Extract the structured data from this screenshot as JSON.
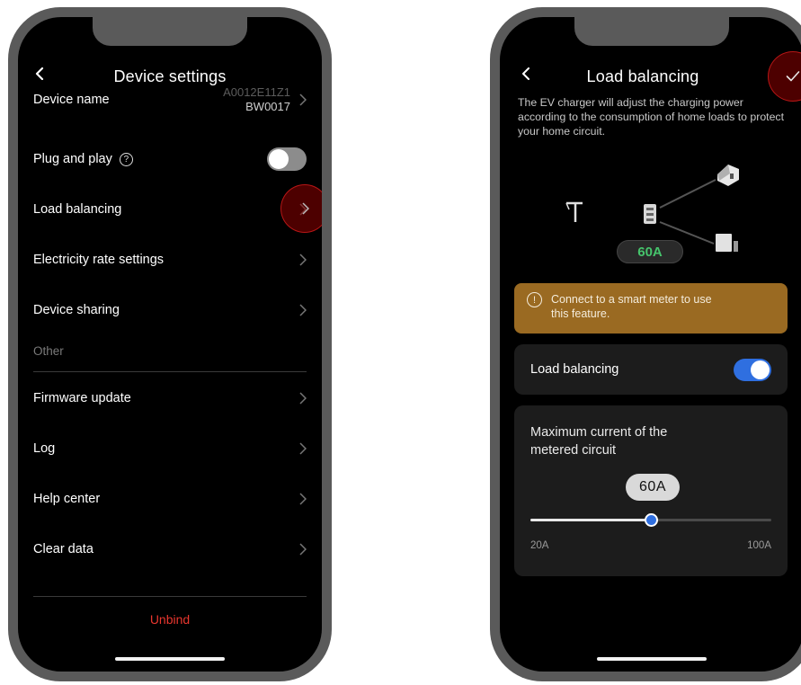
{
  "left_phone": {
    "title": "Device settings",
    "device_name": {
      "label": "Device name",
      "value_line1": "A0012E11Z1",
      "value_line2": "BW0017"
    },
    "plug_and_play": {
      "label": "Plug and play",
      "help_icon_glyph": "?",
      "enabled": false
    },
    "load_balancing": {
      "label": "Load balancing"
    },
    "electricity_rate": {
      "label": "Electricity rate settings"
    },
    "device_sharing": {
      "label": "Device sharing"
    },
    "section_other": "Other",
    "firmware_update": {
      "label": "Firmware update"
    },
    "log": {
      "label": "Log"
    },
    "help_center": {
      "label": "Help center"
    },
    "clear_data": {
      "label": "Clear data"
    },
    "unbind_label": "Unbind"
  },
  "right_phone": {
    "title": "Load balancing",
    "confirm_icon": "check-icon",
    "description": "The EV charger will adjust the charging power according to the consumption of home loads to protect your home circuit.",
    "diagram_current": "60A",
    "warning": {
      "icon_glyph": "!",
      "text": "Connect to a smart meter to use this feature."
    },
    "load_balancing_toggle": {
      "label": "Load balancing",
      "enabled": true
    },
    "max_current": {
      "label": "Maximum current of the metered circuit",
      "value_label": "60A",
      "value": 60,
      "min_label": "20A",
      "max_label": "100A",
      "min": 20,
      "max": 100
    }
  },
  "colors": {
    "background": "#000000",
    "accent_blue": "#2f6fe0",
    "warning_bg": "#9a6a22",
    "unbind_red": "#e8362e",
    "highlight_red": "#8c0000",
    "current_green": "#46c46c"
  }
}
